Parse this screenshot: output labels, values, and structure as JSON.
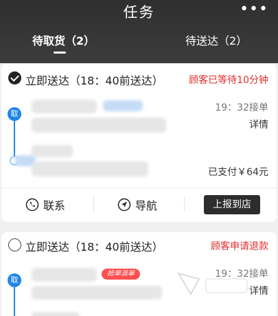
{
  "header": {
    "title": "任务",
    "more_icon": "more-dots-icon",
    "tabs": [
      {
        "label": "待取货（2）",
        "active": true
      },
      {
        "label": "待送达（2）",
        "active": false
      }
    ]
  },
  "orders": [
    {
      "type": "立即送达（18：40前送达）",
      "status": "顾客已等待10分钟",
      "pickup_badge": "取",
      "accept_time": "19：32接单",
      "detail_label": "详情",
      "paid": "已支付￥64元",
      "actions": {
        "contact": "联系",
        "navigate": "导航",
        "report": "上报到店"
      }
    },
    {
      "type": "立即送达（18：40前送达）",
      "status": "顾客申请退款",
      "pickup_badge": "取",
      "grab_tag": "抢单派单",
      "accept_time": "19：32接单",
      "detail_label": "详情"
    }
  ],
  "colors": {
    "header_bg": "#333333",
    "status_red": "#e22a2a",
    "pickup_blue": "#1f86e8"
  }
}
